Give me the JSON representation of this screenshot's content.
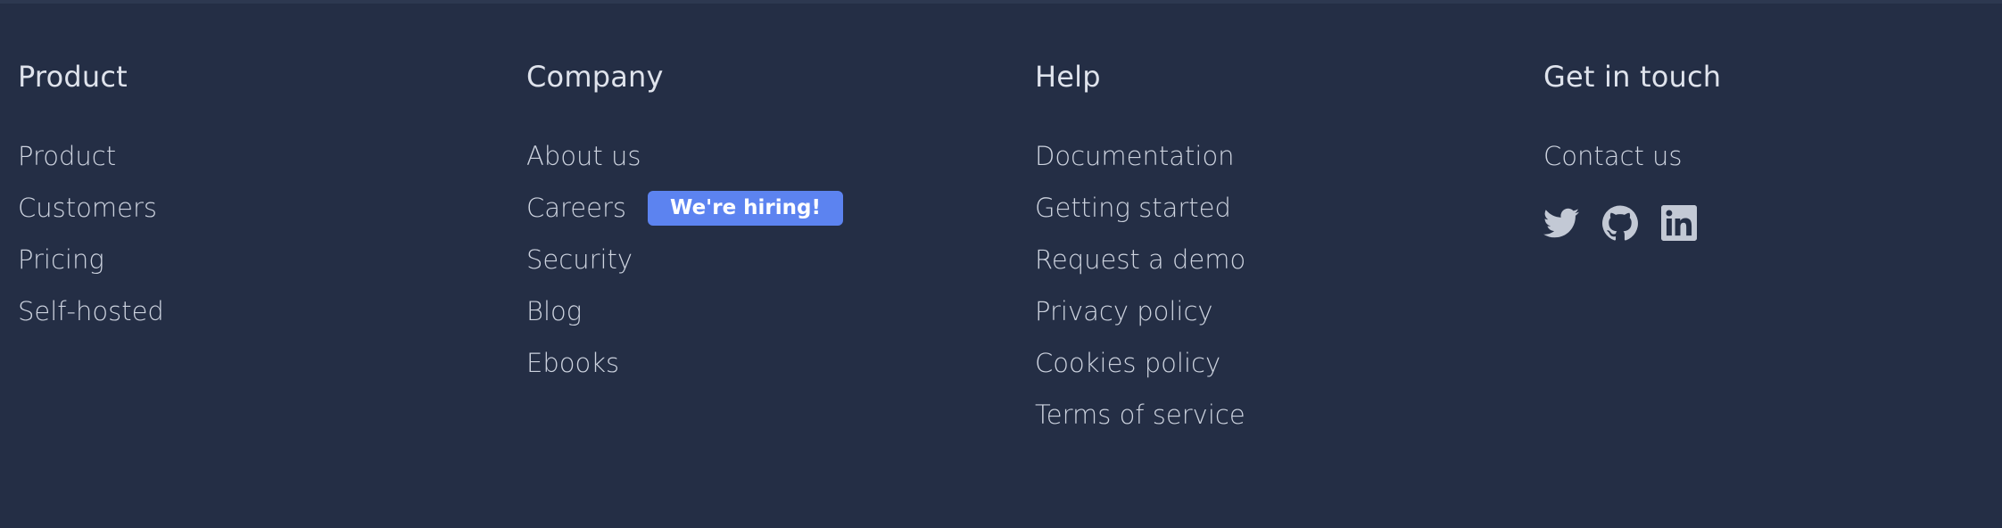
{
  "footer": {
    "columns": [
      {
        "heading": "Product",
        "links": [
          "Product",
          "Customers",
          "Pricing",
          "Self-hosted"
        ]
      },
      {
        "heading": "Company",
        "links": [
          "About us",
          "Careers",
          "Security",
          "Blog",
          "Ebooks"
        ],
        "badge": "We're hiring!"
      },
      {
        "heading": "Help",
        "links": [
          "Documentation",
          "Getting started",
          "Request a demo",
          "Privacy policy",
          "Cookies policy",
          "Terms of service"
        ]
      },
      {
        "heading": "Get in touch",
        "links": [
          "Contact us"
        ],
        "social": [
          "twitter-icon",
          "github-icon",
          "linkedin-icon"
        ]
      }
    ]
  },
  "colors": {
    "background": "#242e45",
    "heading": "#dfe3ec",
    "link": "#cdd3df",
    "badge": "#5c83f0",
    "icon": "#c3c9d5"
  }
}
